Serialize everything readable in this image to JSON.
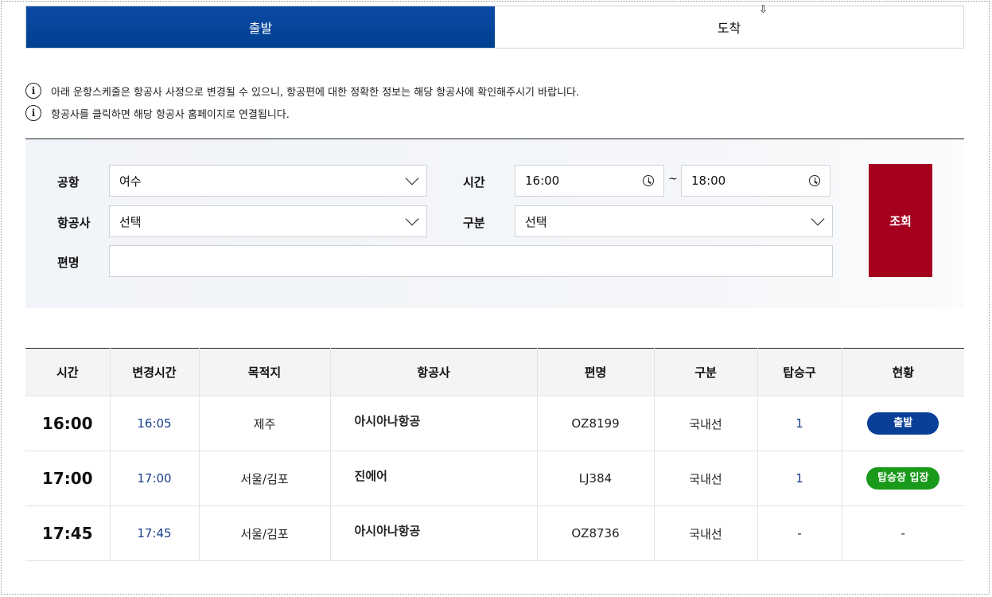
{
  "tabs": [
    {
      "label": "출발",
      "active": true
    },
    {
      "label": "도착",
      "active": false
    }
  ],
  "notices": [
    "아래 운항스케줄은 항공사 사정으로 변경될 수 있으니, 항공편에 대한 정확한 정보는 해당 항공사에 확인해주시기 바랍니다.",
    "항공사를 클릭하면 해당 항공사 홈페이지로 연결됩니다."
  ],
  "search": {
    "airport_label": "공항",
    "airport_value": "여수",
    "airline_label": "항공사",
    "airline_value": "선택",
    "flight_label": "편명",
    "flight_value": "",
    "time_label": "시간",
    "time_from": "16:00",
    "time_sep": "~",
    "time_to": "18:00",
    "type_label": "구분",
    "type_value": "선택",
    "search_button": "조회"
  },
  "table": {
    "headers": [
      "시간",
      "변경시간",
      "목적지",
      "항공사",
      "편명",
      "구분",
      "탑승구",
      "현황"
    ],
    "rows": [
      {
        "time": "16:00",
        "changed": "16:05",
        "destination": "제주",
        "airline": "아시아나항공",
        "flight": "OZ8199",
        "type": "국내선",
        "gate": "1",
        "status": "출발",
        "status_color": "#0a3f97"
      },
      {
        "time": "17:00",
        "changed": "17:00",
        "destination": "서울/김포",
        "airline": "진에어",
        "flight": "LJ384",
        "type": "국내선",
        "gate": "1",
        "status": "탑승장 입장",
        "status_color": "#1a9a1a"
      },
      {
        "time": "17:45",
        "changed": "17:45",
        "destination": "서울/김포",
        "airline": "아시아나항공",
        "flight": "OZ8736",
        "type": "국내선",
        "gate": "-",
        "status": "-",
        "status_color": ""
      }
    ]
  },
  "colors": {
    "primary": "#00408f",
    "search_button": "#a5001e",
    "boarding": "#1a9a1a"
  }
}
